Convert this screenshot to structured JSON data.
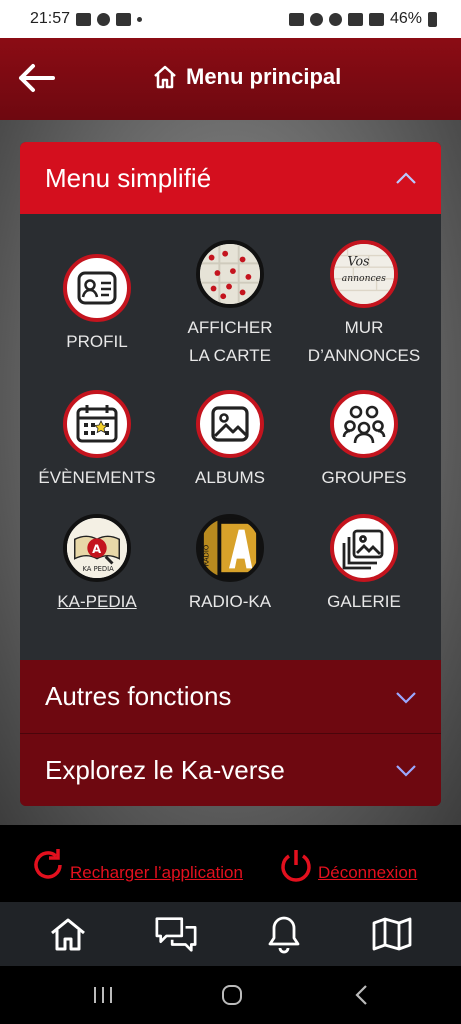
{
  "status": {
    "time": "21:57",
    "battery": "46%"
  },
  "header": {
    "title": "Menu principal"
  },
  "sections": {
    "simplified": "Menu simplifié",
    "other": "Autres fonctions",
    "explore": "Explorez le Ka-verse"
  },
  "menu": {
    "profil": "PROFIL",
    "carte_1": "AFFICHER",
    "carte_2": "LA CARTE",
    "mur_1": "MUR",
    "mur_2": "D’ANNONCES",
    "mur_badge_1": "Vos",
    "mur_badge_2": "annonces",
    "evenements": "ÉVÈNEMENTS",
    "albums": "ALBUMS",
    "groupes": "GROUPES",
    "kapedia": "KA-PEDIA",
    "kapedia_logo": "KA PEDIA",
    "radio": "RADIO-KA",
    "radio_logo": "RADIO",
    "galerie": "GALERIE"
  },
  "footer": {
    "reload": "Recharger l’application ",
    "logout": "Déconnexion"
  },
  "colors": {
    "brand_red": "#d40f1e",
    "dark_red": "#6e0810",
    "panel": "#2a2d31"
  },
  "icons": [
    "arrow-left-icon",
    "home-icon",
    "chevron-up-icon",
    "chevron-down-icon",
    "reload-icon",
    "power-icon",
    "chat-icon",
    "bell-icon",
    "map-icon"
  ]
}
